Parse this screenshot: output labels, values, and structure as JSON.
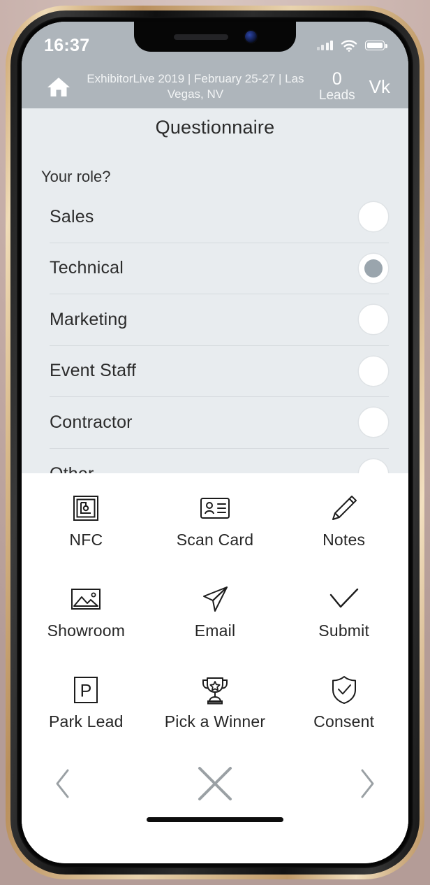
{
  "status_bar": {
    "time": "16:37",
    "signal_icon": "cellular-signal-icon",
    "wifi_icon": "wifi-icon",
    "battery_icon": "battery-full-icon"
  },
  "app_header": {
    "home_icon": "home-icon",
    "event_title": "ExhibitorLive 2019 | February 25-27 | Las Vegas, NV",
    "leads_count": "0",
    "leads_label": "Leads",
    "user_initials": "Vk",
    "background_color": "#aeb5bb"
  },
  "questionnaire": {
    "title": "Questionnaire",
    "question": "Your role?",
    "panel_color": "#e8ecef",
    "selected_option": "Technical",
    "options": [
      {
        "label": "Sales",
        "selected": false
      },
      {
        "label": "Technical",
        "selected": true
      },
      {
        "label": "Marketing",
        "selected": false
      },
      {
        "label": "Event Staff",
        "selected": false
      },
      {
        "label": "Contractor",
        "selected": false
      },
      {
        "label": "Other",
        "selected": false
      }
    ]
  },
  "toolbar": {
    "rows": [
      [
        {
          "label": "NFC",
          "icon": "nfc-icon"
        },
        {
          "label": "Scan Card",
          "icon": "scan-card-icon"
        },
        {
          "label": "Notes",
          "icon": "pencil-icon"
        }
      ],
      [
        {
          "label": "Showroom",
          "icon": "image-icon"
        },
        {
          "label": "Email",
          "icon": "paper-plane-icon"
        },
        {
          "label": "Submit",
          "icon": "check-icon"
        }
      ],
      [
        {
          "label": "Park Lead",
          "icon": "parking-p-icon"
        },
        {
          "label": "Pick a Winner",
          "icon": "trophy-icon"
        },
        {
          "label": "Consent",
          "icon": "shield-check-icon"
        }
      ]
    ]
  },
  "bottom_nav": {
    "back_icon": "chevron-left-icon",
    "close_icon": "close-x-icon",
    "forward_icon": "chevron-right-icon",
    "accent_color": "#9aa0a4"
  }
}
